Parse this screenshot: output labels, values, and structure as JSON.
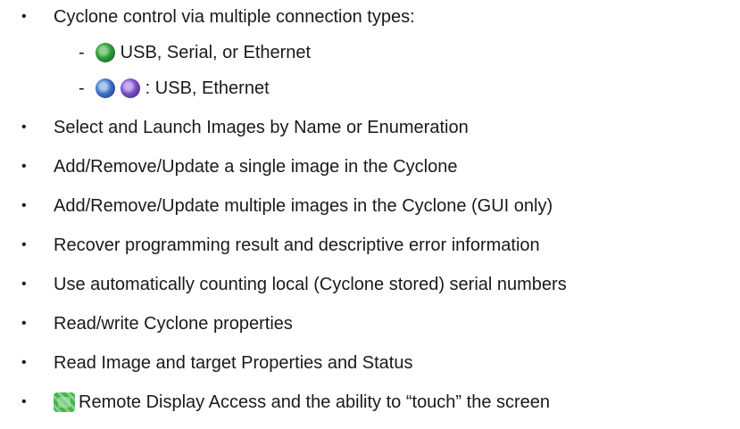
{
  "items": [
    {
      "bullet": "•",
      "text": "Cyclone control via multiple connection types:"
    },
    {
      "bullet": "•",
      "text": "Select and Launch Images by Name or Enumeration"
    },
    {
      "bullet": "•",
      "text": "Add/Remove/Update a single image in the Cyclone"
    },
    {
      "bullet": "•",
      "text": "Add/Remove/Update multiple images in the Cyclone (GUI only)"
    },
    {
      "bullet": "•",
      "text": "Recover programming result and descriptive error information"
    },
    {
      "bullet": "•",
      "text": "Use automatically counting local (Cyclone stored) serial numbers"
    },
    {
      "bullet": "•",
      "text": "Read/write Cyclone properties"
    },
    {
      "bullet": "•",
      "text": "Read Image and target Properties and Status"
    },
    {
      "bullet": "•",
      "text": "Remote Display Access and the ability to “touch” the screen"
    }
  ],
  "subitems": [
    {
      "dash": "-",
      "text": "USB, Serial, or Ethernet",
      "icons": [
        "green-cyclone-icon"
      ]
    },
    {
      "dash": "-",
      "text": ": USB, Ethernet",
      "icons": [
        "blue-cyclone-icon",
        "purple-cyclone-icon"
      ]
    }
  ],
  "colors": {
    "text": "#1a1a1a",
    "green_icon": "#2f9a3c",
    "blue_icon": "#3e73c7",
    "purple_icon": "#7b4fc6"
  }
}
